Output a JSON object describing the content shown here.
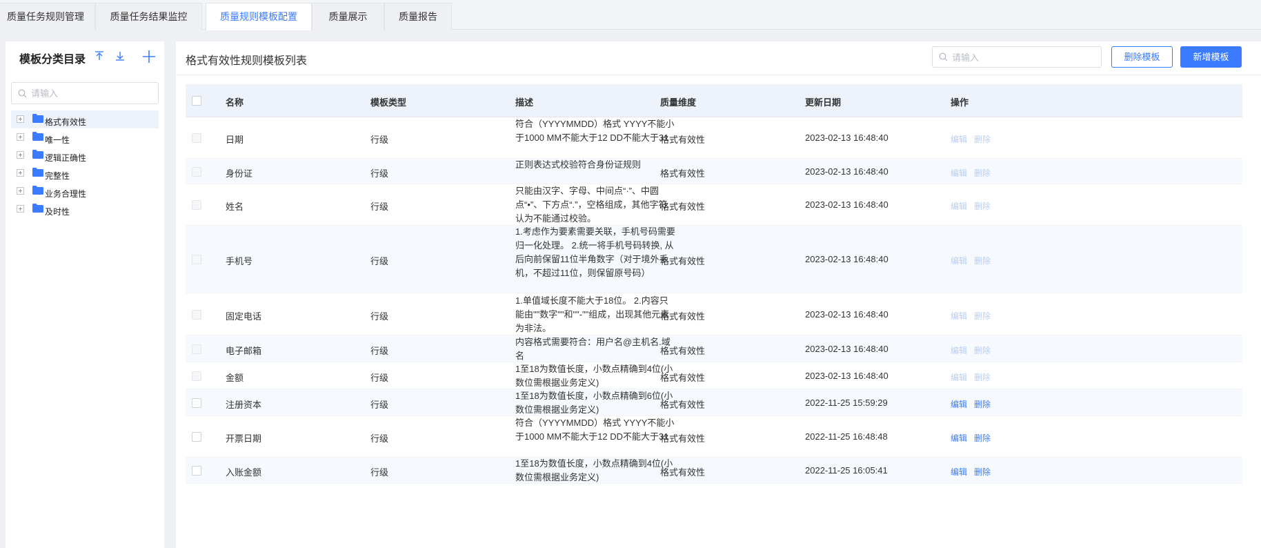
{
  "tabs": [
    {
      "label": "质量任务规则管理",
      "active": false
    },
    {
      "label": "质量任务结果监控",
      "active": false
    },
    {
      "label": "质量规则模板配置",
      "active": true
    },
    {
      "label": "质量展示",
      "active": false
    },
    {
      "label": "质量报告",
      "active": false
    }
  ],
  "sidebar": {
    "title": "模板分类目录",
    "search_placeholder": "请输入",
    "items": [
      {
        "label": "格式有效性",
        "selected": true
      },
      {
        "label": "唯一性",
        "selected": false
      },
      {
        "label": "逻辑正确性",
        "selected": false
      },
      {
        "label": "完整性",
        "selected": false
      },
      {
        "label": "业务合理性",
        "selected": false
      },
      {
        "label": "及时性",
        "selected": false
      }
    ]
  },
  "main": {
    "title": "格式有效性规则模板列表",
    "search_placeholder": "请输入",
    "delete_button": "删除模板",
    "add_button": "新增模板",
    "columns": [
      "名称",
      "模板类型",
      "描述",
      "质量维度",
      "更新日期",
      "操作"
    ],
    "rows": [
      {
        "name": "日期",
        "type": "行级",
        "desc": "符合（YYYYMMDD）格式 YYYY不能小于1000 MM不能大于12 DD不能大于31",
        "dimension": "格式有效性",
        "date": "2023-02-13 16:48:40",
        "edit": "编辑",
        "delete": "删除",
        "enabled": false
      },
      {
        "name": "身份证",
        "type": "行级",
        "desc": "正则表达式校验符合身份证规则",
        "dimension": "格式有效性",
        "date": "2023-02-13 16:48:40",
        "edit": "编辑",
        "delete": "删除",
        "enabled": false
      },
      {
        "name": "姓名",
        "type": "行级",
        "desc": "只能由汉字、字母、中间点“·”、中圆点“•”、下方点“.”，空格组成，其他字符认为不能通过校验。",
        "dimension": "格式有效性",
        "date": "2023-02-13 16:48:40",
        "edit": "编辑",
        "delete": "删除",
        "enabled": false
      },
      {
        "name": "手机号",
        "type": "行级",
        "desc": "1.考虑作为要素需要关联，手机号码需要归一化处理。 2.统一将手机号码转换, 从后向前保留11位半角数字（对于境外手机，不超过11位，则保留原号码）",
        "dimension": "格式有效性",
        "date": "2023-02-13 16:48:40",
        "edit": "编辑",
        "delete": "删除",
        "enabled": false
      },
      {
        "name": "固定电话",
        "type": "行级",
        "desc": "1.单值域长度不能大于18位。 2.内容只能由\"\"数字\"\"和\"\"-\"\"组成，出现其他元素为非法。",
        "dimension": "格式有效性",
        "date": "2023-02-13 16:48:40",
        "edit": "编辑",
        "delete": "删除",
        "enabled": false
      },
      {
        "name": "电子邮箱",
        "type": "行级",
        "desc": "内容格式需要符合：用户名@主机名.域名",
        "dimension": "格式有效性",
        "date": "2023-02-13 16:48:40",
        "edit": "编辑",
        "delete": "删除",
        "enabled": false
      },
      {
        "name": "金额",
        "type": "行级",
        "desc": "1至18为数值长度，小数点精确到4位(小数位需根据业务定义)",
        "dimension": "格式有效性",
        "date": "2023-02-13 16:48:40",
        "edit": "编辑",
        "delete": "删除",
        "enabled": false
      },
      {
        "name": "注册资本",
        "type": "行级",
        "desc": "1至18为数值长度，小数点精确到6位(小数位需根据业务定义)",
        "dimension": "格式有效性",
        "date": "2022-11-25 15:59:29",
        "edit": "编辑",
        "delete": "删除",
        "enabled": true
      },
      {
        "name": "开票日期",
        "type": "行级",
        "desc": "符合（YYYYMMDD）格式 YYYY不能小于1000 MM不能大于12 DD不能大于31",
        "dimension": "格式有效性",
        "date": "2022-11-25 16:48:48",
        "edit": "编辑",
        "delete": "删除",
        "enabled": true
      },
      {
        "name": "入账金额",
        "type": "行级",
        "desc": "1至18为数值长度，小数点精确到4位(小数位需根据业务定义)",
        "dimension": "格式有效性",
        "date": "2022-11-25 16:05:41",
        "edit": "编辑",
        "delete": "删除",
        "enabled": true
      }
    ]
  }
}
